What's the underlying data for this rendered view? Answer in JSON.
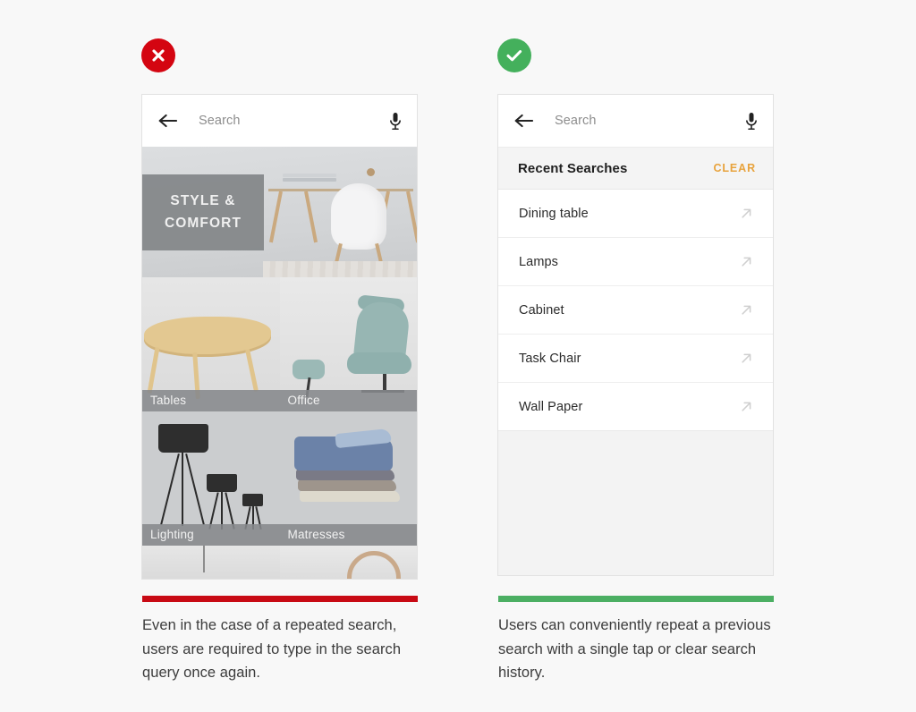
{
  "page": {
    "background_color": "#f8f8f8"
  },
  "columns": [
    {
      "id": "bad-example",
      "badge": {
        "name": "error-badge",
        "icon": "cross-icon",
        "color": "#d40511"
      },
      "accent_color": "#c80a14",
      "caption": "Even in the case of a repeated search, users are required to type in the search query once again.",
      "screen": {
        "searchbar": {
          "back_icon": "arrow-left-icon",
          "placeholder": "Search",
          "value": "",
          "mic_icon": "microphone-icon"
        },
        "hero": {
          "banner_line1": "STYLE &",
          "banner_line2": "COMFORT"
        },
        "tiles": [
          {
            "label": "Tables"
          },
          {
            "label": "Office"
          },
          {
            "label": "Lighting"
          },
          {
            "label": "Matresses"
          }
        ]
      }
    },
    {
      "id": "good-example",
      "badge": {
        "name": "success-badge",
        "icon": "check-icon",
        "color": "#44b05c"
      },
      "accent_color": "#4caf63",
      "caption": "Users can conveniently repeat a previous search with a single tap or clear search history.",
      "screen": {
        "searchbar": {
          "back_icon": "arrow-left-icon",
          "placeholder": "Search",
          "value": "",
          "mic_icon": "microphone-icon"
        },
        "recent": {
          "title": "Recent Searches",
          "clear_label": "CLEAR",
          "clear_color": "#e8a33d",
          "items": [
            {
              "label": "Dining table",
              "icon": "arrow-up-right-icon"
            },
            {
              "label": "Lamps",
              "icon": "arrow-up-right-icon"
            },
            {
              "label": "Cabinet",
              "icon": "arrow-up-right-icon"
            },
            {
              "label": "Task Chair",
              "icon": "arrow-up-right-icon"
            },
            {
              "label": "Wall Paper",
              "icon": "arrow-up-right-icon"
            }
          ]
        }
      }
    }
  ]
}
